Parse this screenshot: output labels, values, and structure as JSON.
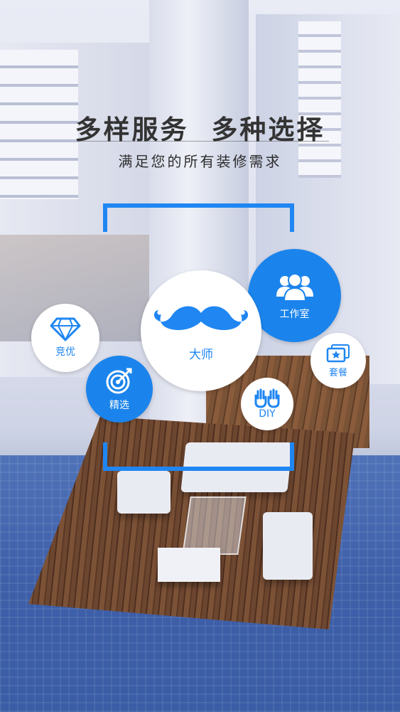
{
  "headline": {
    "title": "多样服务  多种选择",
    "subtitle": "满足您的所有装修需求"
  },
  "services": {
    "master": {
      "label": "大师",
      "icon": "mustache-icon"
    },
    "studio": {
      "label": "工作室",
      "icon": "team-icon"
    },
    "compete": {
      "label": "竞优",
      "icon": "diamond-icon"
    },
    "select": {
      "label": "精选",
      "icon": "target-icon"
    },
    "package": {
      "label": "套餐",
      "icon": "star-card-icon"
    },
    "diy": {
      "label": "DIY",
      "icon": "hands-icon"
    }
  },
  "colors": {
    "accent": "#1f86f2",
    "circle_blue": "#1b84ec",
    "text_dark": "#333333"
  }
}
